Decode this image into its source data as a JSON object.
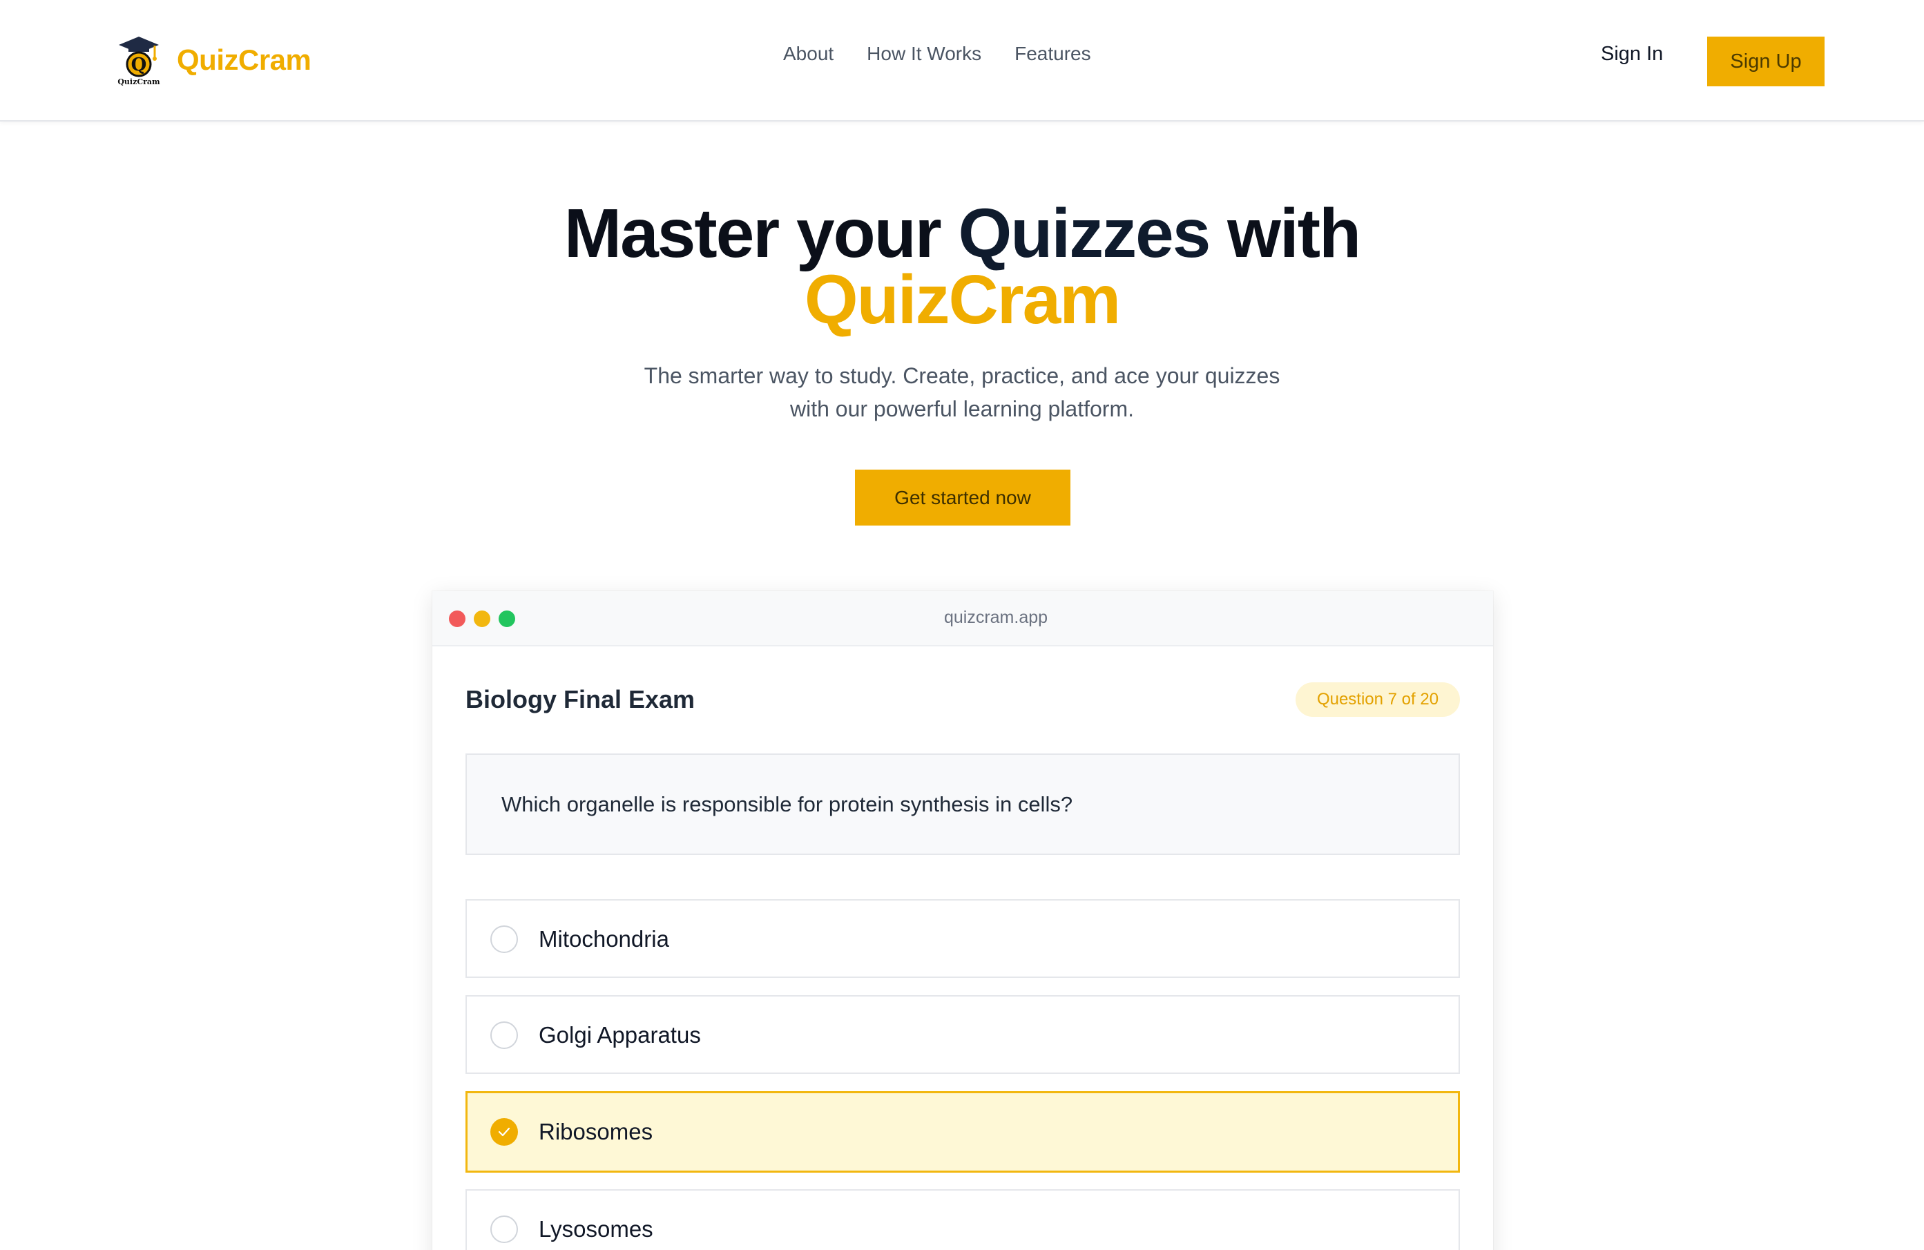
{
  "header": {
    "brand_name": "QuizCram",
    "logo_text": "QuizCram",
    "nav": [
      "About",
      "How It Works",
      "Features"
    ],
    "sign_in": "Sign In",
    "sign_up": "Sign Up"
  },
  "hero": {
    "title_part1": "Master your ",
    "title_part2": "Quizzes",
    "title_part3": " with",
    "title_accent": "QuizCram",
    "subtitle_line1": "The smarter way to study. Create, practice, and ace your quizzes",
    "subtitle_line2": "with our powerful learning platform.",
    "cta": "Get started now"
  },
  "window": {
    "url": "quizcram.app",
    "quiz_title": "Biology Final Exam",
    "progress": "Question 7 of 20",
    "question": "Which organelle is responsible for protein synthesis in cells?",
    "options": [
      {
        "label": "Mitochondria",
        "selected": false
      },
      {
        "label": "Golgi Apparatus",
        "selected": false
      },
      {
        "label": "Ribosomes",
        "selected": true
      },
      {
        "label": "Lysosomes",
        "selected": false
      }
    ]
  },
  "colors": {
    "accent": "#f0ad00",
    "text_dark": "#0b0f19",
    "muted": "#4b5563",
    "selected_bg": "#fef8d6"
  }
}
